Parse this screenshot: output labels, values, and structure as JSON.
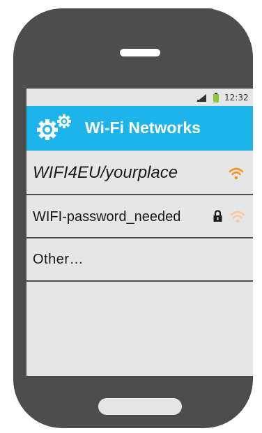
{
  "status_bar": {
    "time": "12:32"
  },
  "header": {
    "title": "Wi-Fi Networks"
  },
  "networks": [
    {
      "name": "WIFI4EU/yourplace",
      "secured": false,
      "signal_color": "#f7931e",
      "signal_level": 1.0
    },
    {
      "name": "WIFI-password_needed",
      "secured": true,
      "signal_color": "#f8c8a0",
      "signal_level": 1.0
    },
    {
      "name": "Other…"
    }
  ],
  "colors": {
    "accent": "#1db4ea",
    "battery": "#8cc63f",
    "phone_body": "#4d4d4d",
    "screen": "#e6e6e6"
  }
}
